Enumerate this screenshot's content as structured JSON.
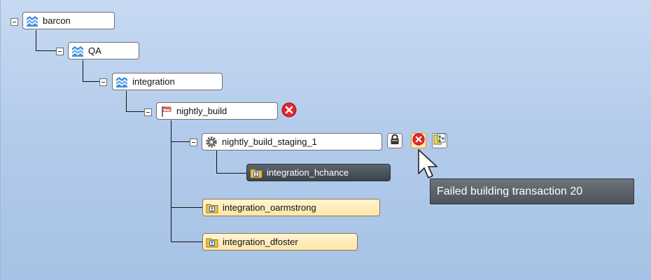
{
  "tree": {
    "nodes": [
      {
        "label": "barcon",
        "kind": "depot",
        "expanded": true
      },
      {
        "label": "QA",
        "kind": "stream",
        "expanded": true
      },
      {
        "label": "integration",
        "kind": "stream",
        "expanded": true
      },
      {
        "label": "nightly_build",
        "kind": "build-stream",
        "expanded": true
      },
      {
        "label": "nightly_build_staging_1",
        "kind": "staging",
        "expanded": true
      },
      {
        "label": "integration_hchance",
        "kind": "workspace",
        "selected": true
      },
      {
        "label": "integration_oarmstrong",
        "kind": "workspace"
      },
      {
        "label": "integration_dfoster",
        "kind": "workspace"
      }
    ]
  },
  "tooltip": {
    "text": "Failed building transaction 20"
  },
  "colors": {
    "background": "#b4cceb",
    "error": "#e3262f",
    "workspace_fill": "#fde6a9",
    "selected_fill": "#3b434c"
  },
  "icons": {
    "stream": "stream-waves-icon",
    "build": "build-flag-icon",
    "staging": "gear-icon",
    "workspace": "user-folder-icon",
    "lock": "lock-icon",
    "error": "error-icon",
    "tree_view": "tree-view-icon"
  }
}
